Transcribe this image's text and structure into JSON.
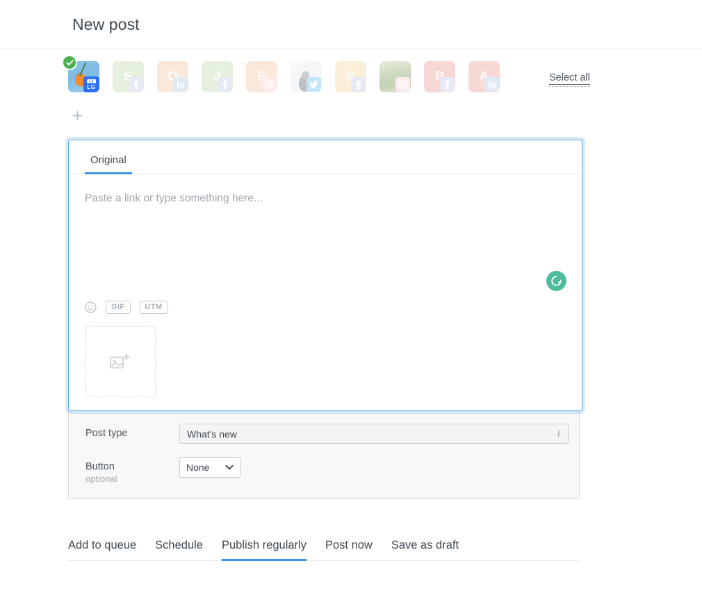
{
  "header": {
    "title": "New post"
  },
  "profiles": {
    "select_all_label": "Select all",
    "add_icon": "plus-icon",
    "items": [
      {
        "letter": "",
        "network": "gmb",
        "network_icon": "google-my-business-icon",
        "style": "photo-persimmon",
        "selected": true,
        "badge_label": "LG"
      },
      {
        "letter": "S",
        "network": "facebook",
        "network_icon": "facebook-icon",
        "style": "solid-green",
        "selected": false
      },
      {
        "letter": "O",
        "network": "linkedin",
        "network_icon": "linkedin-icon",
        "style": "solid-peach",
        "selected": false
      },
      {
        "letter": "J",
        "network": "facebook",
        "network_icon": "facebook-icon",
        "style": "solid-green",
        "selected": false
      },
      {
        "letter": "F",
        "network": "instagram",
        "network_icon": "instagram-icon",
        "style": "solid-peach",
        "selected": false
      },
      {
        "letter": "",
        "network": "twitter",
        "network_icon": "twitter-icon",
        "style": "photo-snow",
        "selected": false
      },
      {
        "letter": "S",
        "network": "facebook",
        "network_icon": "facebook-icon",
        "style": "solid-cream",
        "selected": false
      },
      {
        "letter": "",
        "network": "instagram",
        "network_icon": "instagram-icon",
        "style": "photo-forest",
        "selected": false
      },
      {
        "letter": "P",
        "network": "facebook",
        "network_icon": "facebook-icon",
        "style": "solid-pink",
        "selected": false
      },
      {
        "letter": "A",
        "network": "linkedin",
        "network_icon": "linkedin-icon",
        "style": "solid-pink",
        "selected": false
      }
    ]
  },
  "composer": {
    "tab_label": "Original",
    "placeholder": "Paste a link or type something here...",
    "emoji_icon": "emoji-smiley-icon",
    "gif_label": "GIF",
    "utm_label": "UTM",
    "grammarly_icon": "grammarly-icon",
    "media_icon": "add-image-icon"
  },
  "options": {
    "post_type": {
      "label": "Post type",
      "value": "What's new",
      "info_icon": "info-icon"
    },
    "button": {
      "label": "Button",
      "sublabel": "optional",
      "value": "None",
      "caret_icon": "chevron-down-icon"
    }
  },
  "bottom_tabs": [
    {
      "label": "Add to queue",
      "active": false
    },
    {
      "label": "Schedule",
      "active": false
    },
    {
      "label": "Publish regularly",
      "active": true
    },
    {
      "label": "Post now",
      "active": false
    },
    {
      "label": "Save as draft",
      "active": false
    }
  ],
  "colors": {
    "accent_blue": "#3d93dd",
    "focus_border": "#55a7e8",
    "check_green": "#4caf50",
    "grammarly_green": "#4cbd9c",
    "panel_bg": "#f8f8f8"
  }
}
